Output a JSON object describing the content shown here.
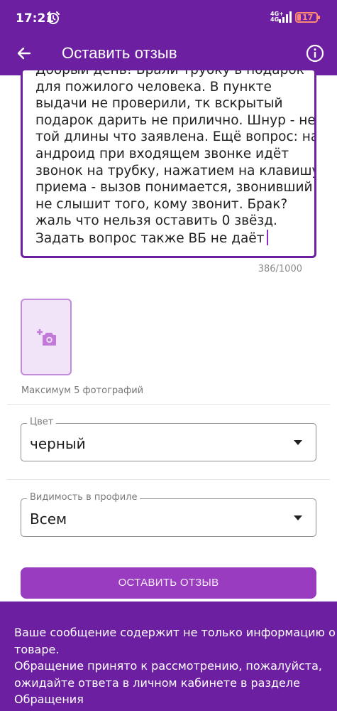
{
  "status_bar": {
    "time": "17:21",
    "network_top": "4G+",
    "network_bottom": "4G",
    "battery": "17",
    "icons": [
      "alarm-icon",
      "signal-icon",
      "battery-icon"
    ]
  },
  "app_bar": {
    "title": "Оставить отзыв",
    "back_icon": "arrow-left-icon",
    "info_icon": "info-icon"
  },
  "review": {
    "lines": [
      "Добрый день! Брали трубку в подарок",
      "для пожилого человека. В пункте",
      "выдачи не проверили, тк вскрытый",
      "подарок дарить не прилично. Шнур - не",
      "той длины что заявлена. Ещё вопрос: на",
      "андроид при входящем звонке идёт",
      "звонок на трубку, нажатием на клавишу",
      "приема - вызов понимается, звонивший",
      "не слышит того, кому звонит. Брак?",
      "жаль что нельзя оставить 0 звёзд.",
      "Задать вопрос также ВБ не даёт"
    ],
    "counter": "386/1000"
  },
  "photos": {
    "add_icon": "add-photo-icon",
    "caption": "Максимум 5 фотографий"
  },
  "color_field": {
    "label": "Цвет",
    "value": "черный"
  },
  "visibility_field": {
    "label": "Видимость в профиле",
    "value": "Всем"
  },
  "submit_label": "ОСТАВИТЬ ОТЗЫВ",
  "snackbar": {
    "lines": [
      "Ваше сообщение содержит не только информацию о",
      "товаре.",
      "Обращение принято к рассмотрению, пожалуйста,",
      "ожидайте ответа в личном кабинете в разделе",
      "Обращения"
    ]
  },
  "colors": {
    "primary": "#6c1fa0",
    "button": "#9a3cbf",
    "photo_tile_bg": "#f1e3f8",
    "photo_tile_border": "#c28bdc",
    "battery_low": "#ff8a73"
  }
}
